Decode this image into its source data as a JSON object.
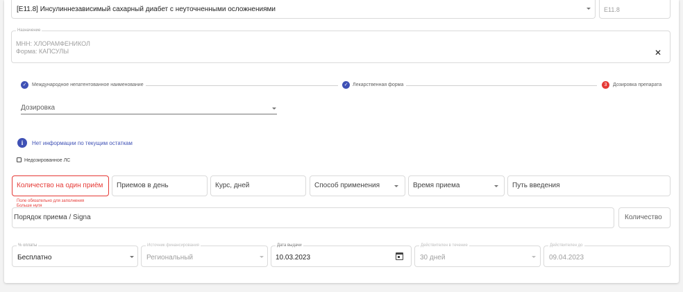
{
  "diagnosis": {
    "value": "[E11.8] Инсулиннезависимый сахарный диабет с неуточненными осложнениями",
    "code": "E11.8"
  },
  "drug": {
    "label": "Назначение",
    "mnn": "МНН: ХЛОРАМФЕНИКОЛ",
    "form": "Форма: КАПСУЛЫ"
  },
  "stepper": [
    {
      "label": "Международное непатентованное наименование",
      "status": "done",
      "icon": "check-icon"
    },
    {
      "label": "Лекарственная форма",
      "status": "done",
      "icon": "check-icon"
    },
    {
      "label": "Дозировка препарата",
      "status": "active",
      "number": "3"
    }
  ],
  "dosage": {
    "placeholder": "Дозировка"
  },
  "stock_info": {
    "text": "Нет информации по текущим остаткам",
    "icon": "info-icon"
  },
  "checkbox": {
    "label": "Недозированное ЛС"
  },
  "fields": {
    "per_dose": "Количество на один приём",
    "per_day": "Приемов в день",
    "course": "Курс, дней",
    "method": "Способ применения",
    "time": "Время приема",
    "route": "Путь введения",
    "error": "Поле обязательно для заполнения",
    "error2": "Больше нуля",
    "signa": "Порядок приема / Signa",
    "quantity": "Количество"
  },
  "bottom": {
    "payment": {
      "label": "% оплаты",
      "value": "Бесплатно"
    },
    "funding": {
      "label": "Источник финансирования",
      "value": "Региональный"
    },
    "issue_date": {
      "label": "Дата выдачи",
      "value": "10.03.2023"
    },
    "validity": {
      "label": "Действителен в течение",
      "value": "30 дней"
    },
    "valid_until": {
      "label": "Действителен до",
      "value": "09.04.2023"
    }
  },
  "colors": {
    "primary": "#3f51b5",
    "error": "#e53935",
    "accent_red": "#e53935"
  }
}
